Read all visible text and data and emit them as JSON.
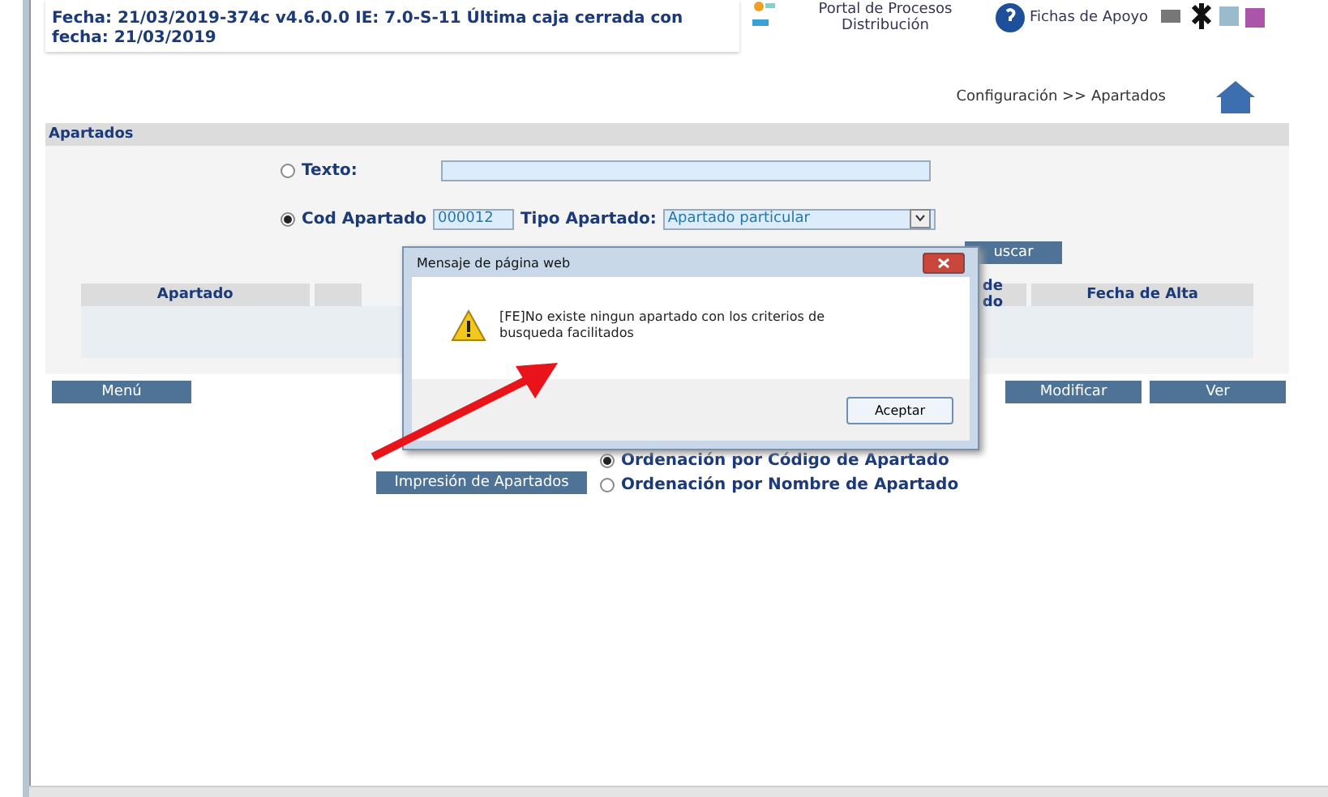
{
  "header": {
    "info": "Fecha: 21/03/2019-374c v4.6.0.0  IE: 7.0-S-11  Última caja cerrada con fecha: 21/03/2019",
    "portal_link": "Portal de Procesos Distribución",
    "help_link": "Fichas de Apoyo",
    "breadcrumb": "Configuración >> Apartados"
  },
  "panel": {
    "title": "Apartados",
    "search_options": [
      {
        "label": "Texto:",
        "selected": false
      },
      {
        "label": "Cod Apartado",
        "selected": true
      }
    ],
    "code_field": {
      "value": "000012"
    },
    "type_label": "Tipo Apartado:",
    "type_select": {
      "value": "Apartado particular"
    },
    "search_button": "uscar",
    "table": {
      "columns": [
        {
          "label": "Apartado"
        },
        {},
        {
          "label": "de do"
        },
        {
          "label": "Fecha de Alta"
        }
      ]
    }
  },
  "buttons": {
    "left": "Menú",
    "right": [
      "Modificar",
      "Ver"
    ]
  },
  "print_button": "Impresión de Apartados",
  "order_options": [
    {
      "label": "Ordenación por Código de Apartado",
      "selected": true
    },
    {
      "label": "Ordenación por Nombre de Apartado",
      "selected": false
    }
  ],
  "dialog": {
    "title": "Mensaje de página web",
    "message": "[FE]No existe ningun apartado con los criterios de busqueda facilitados",
    "button": "Aceptar"
  }
}
